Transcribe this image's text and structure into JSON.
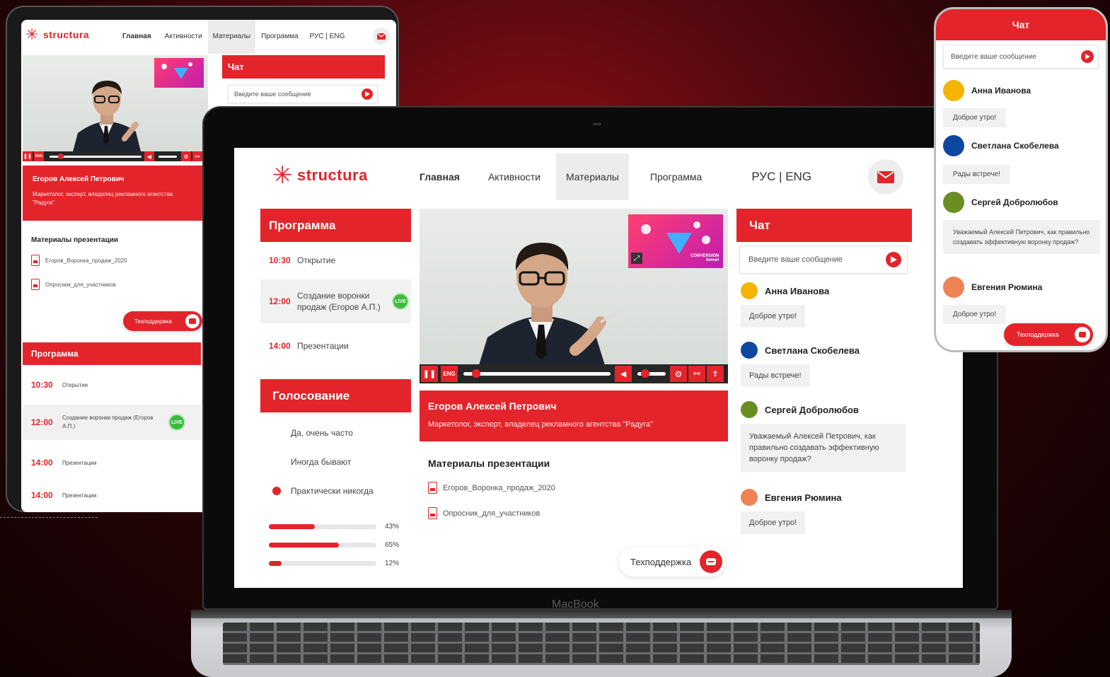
{
  "brand": {
    "logo_text": "structura",
    "device_label": "MacBook",
    "accent_color": "#e3242b"
  },
  "nav": {
    "home": "Главная",
    "activities": "Активности",
    "materials": "Материалы",
    "program": "Программа",
    "language": "РУС | ENG",
    "language_tablet": "РУС | ENG",
    "mail_icon": "mail-icon"
  },
  "program": {
    "title": "Программа",
    "items": [
      {
        "time": "10:30",
        "title": "Открытие"
      },
      {
        "time": "12:00",
        "title": "Создание воронки продаж (Егоров А.П.)",
        "live": "LIVE"
      },
      {
        "time": "14:00",
        "title": "Презентации"
      },
      {
        "time": "14:00",
        "title": "Презентации"
      }
    ]
  },
  "voting": {
    "title": "Голосование",
    "options": [
      "Да, очень часто",
      "Иногда бывают",
      "Практически никогда"
    ],
    "results": [
      {
        "label": "43%",
        "value": 43
      },
      {
        "label": "65%",
        "value": 65
      },
      {
        "label": "12%",
        "value": 12
      }
    ]
  },
  "speaker": {
    "name": "Егоров Алексей Петрович",
    "bio": "Маркетолог, эксперт, владелец рекламного агентства \"Радуга\""
  },
  "player": {
    "lang_button": "ENG",
    "progress": 0.06,
    "volume": 0.12,
    "thumbnail_caption": "CONVERSION funnel"
  },
  "materials": {
    "title": "Материалы презентации",
    "files": [
      "Егоров_Воронка_продаж_2020",
      "Опросник_для_участников"
    ]
  },
  "support": {
    "label": "Техподдержка"
  },
  "chat": {
    "title": "Чат",
    "input_placeholder": "Введите ваше сообщение",
    "messages": [
      {
        "user": "Анна Иванова",
        "color": "#f4b400",
        "text": "Доброе утро!"
      },
      {
        "user": "Светлана Скобелева",
        "color": "#0d47a1",
        "text": "Рады встрече!"
      },
      {
        "user": "Сергей Добролюбов",
        "color": "#6b8e23",
        "text": "Уважаемый Алексей Петрович, как правильно создавать эффективную воронку продаж?"
      },
      {
        "user": "Евгения Рюмина",
        "color": "#ef8354",
        "text": "Доброе утро!"
      }
    ]
  }
}
